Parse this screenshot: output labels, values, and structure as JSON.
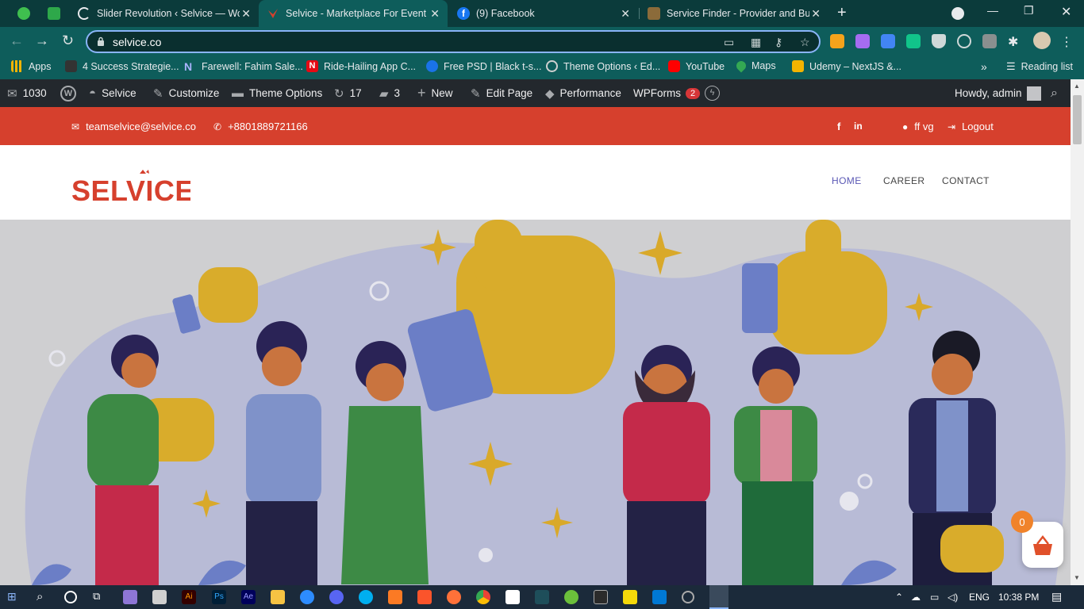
{
  "browser": {
    "tabs": [
      {
        "title": "",
        "icon": "evernote-icon",
        "color": "#3fbf4f"
      },
      {
        "title": "",
        "icon": "sheets-icon",
        "color": "#2ea84a"
      },
      {
        "title": "Slider Revolution ‹ Selvice — Wo",
        "icon": "loading-icon",
        "color": "#e8eaed"
      },
      {
        "title": "Selvice - Marketplace For Event R",
        "icon": "selvice-icon",
        "color": "#d6402d"
      },
      {
        "title": "(9) Facebook",
        "icon": "facebook-icon",
        "color": "#1877f2"
      },
      {
        "title": "Service Finder - Provider and Bus",
        "icon": "servicefinder-icon",
        "color": "#8b6b3a"
      }
    ],
    "url": "selvice.co",
    "bookmarks": [
      {
        "label": "Apps",
        "icon": "apps-grid-icon",
        "color": "#f4b400"
      },
      {
        "label": "4 Success Strategie...",
        "icon": "sf-icon",
        "color": "#333"
      },
      {
        "label": "Farewell: Fahim Sale...",
        "icon": "n-icon",
        "color": "#2d3a8c"
      },
      {
        "label": "Ride-Hailing App C...",
        "icon": "netflix-n-icon",
        "color": "#e50914"
      },
      {
        "label": "Free PSD | Black t-s...",
        "icon": "freepik-icon",
        "color": "#1a73e8"
      },
      {
        "label": "Theme Options ‹ Ed...",
        "icon": "wordpress-icon",
        "color": "#d0d0d0"
      },
      {
        "label": "YouTube",
        "icon": "youtube-icon",
        "color": "#ff0000"
      },
      {
        "label": "Maps",
        "icon": "maps-icon",
        "color": "#34a853"
      },
      {
        "label": "Udemy – NextJS &...",
        "icon": "udemy-icon",
        "color": "#f4b400"
      }
    ],
    "more_bookmarks": "»",
    "reading_list": "Reading list"
  },
  "adminbar": {
    "mail_count": "1030",
    "site_name": "Selvice",
    "customize": "Customize",
    "theme_options": "Theme Options",
    "updates": "17",
    "comments": "3",
    "new": "New",
    "edit_page": "Edit Page",
    "performance": "Performance",
    "wpforms": "WPForms",
    "wpforms_badge": "2",
    "howdy": "Howdy, admin"
  },
  "site": {
    "email": "teamselvice@selvice.co",
    "phone": "+8801889721166",
    "user": "ff vg",
    "logout": "Logout",
    "logo_text": "SELVICE",
    "nav": [
      "HOME",
      "CAREER",
      "CONTACT"
    ],
    "cart_count": "0",
    "brand_color": "#d6402d",
    "nav_active_color": "#5a58b5"
  },
  "taskbar": {
    "language": "ENG",
    "time": "10:38 PM"
  }
}
